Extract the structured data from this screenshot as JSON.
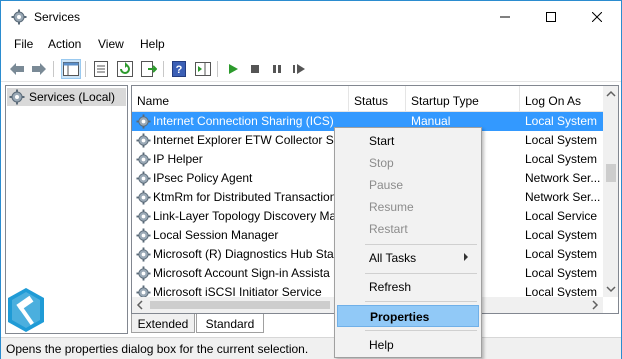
{
  "window": {
    "title": "Services"
  },
  "menubar": [
    "File",
    "Action",
    "View",
    "Help"
  ],
  "tree": {
    "root_label": "Services (Local)"
  },
  "columns": [
    "Name",
    "Status",
    "Startup Type",
    "Log On As"
  ],
  "rows": [
    {
      "name": "Internet Connection Sharing (ICS)",
      "status": "",
      "startup": "Manual",
      "logon": "Local System"
    },
    {
      "name": "Internet Explorer ETW Collector Se",
      "status": "",
      "startup": "",
      "logon": "Local System"
    },
    {
      "name": "IP Helper",
      "status": "",
      "startup": "",
      "logon": "Local System"
    },
    {
      "name": "IPsec Policy Agent",
      "status": "",
      "startup": "ger ...",
      "logon": "Network Ser..."
    },
    {
      "name": "KtmRm for Distributed Transaction",
      "status": "",
      "startup": "ger ...",
      "logon": "Network Ser..."
    },
    {
      "name": "Link-Layer Topology Discovery Ma",
      "status": "",
      "startup": "",
      "logon": "Local Service"
    },
    {
      "name": "Local Session Manager",
      "status": "",
      "startup": "",
      "logon": "Local System"
    },
    {
      "name": "Microsoft (R) Diagnostics Hub Sta",
      "status": "",
      "startup": "",
      "logon": "Local System"
    },
    {
      "name": "Microsoft Account Sign-in Assista",
      "status": "",
      "startup": "ger ...",
      "logon": "Local System"
    },
    {
      "name": "Microsoft iSCSI Initiator Service",
      "status": "",
      "startup": "",
      "logon": "Local System"
    }
  ],
  "tabs": {
    "extended": "Extended",
    "standard": "Standard"
  },
  "statusbar": {
    "text": "Opens the properties dialog box for the current selection."
  },
  "context_menu": {
    "start": "Start",
    "stop": "Stop",
    "pause": "Pause",
    "resume": "Resume",
    "restart": "Restart",
    "all_tasks": "All Tasks",
    "refresh": "Refresh",
    "properties": "Properties",
    "help": "Help"
  },
  "colors": {
    "selection": "#3399ff",
    "menu_highlight": "#91c9f7",
    "window_border": "#2b8ccf"
  }
}
